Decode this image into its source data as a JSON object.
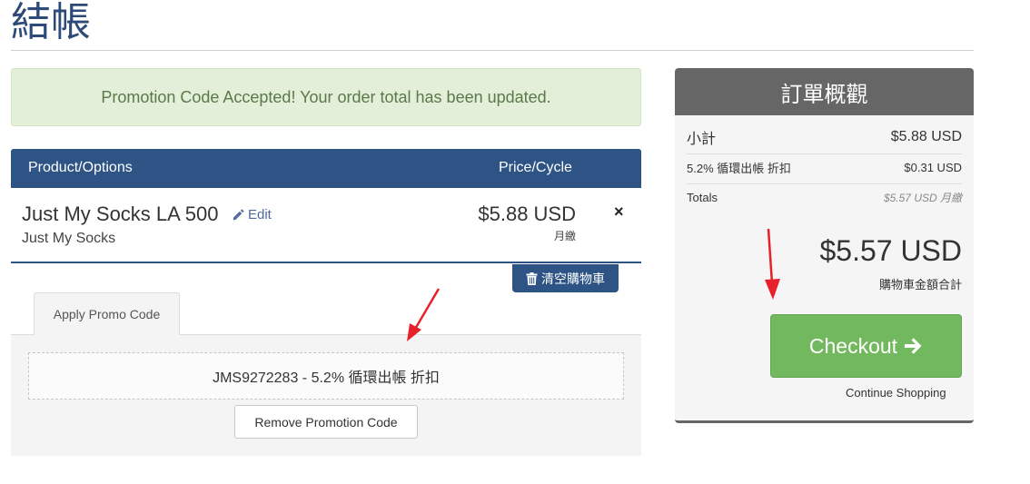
{
  "page": {
    "title": "結帳"
  },
  "alert": {
    "text": "Promotion Code Accepted! Your order total has been updated."
  },
  "cart": {
    "headers": {
      "product": "Product/Options",
      "price": "Price/Cycle"
    },
    "item": {
      "name": "Just My Socks LA 500",
      "edit_label": "Edit",
      "group": "Just My Socks",
      "price": "$5.88 USD",
      "cycle": "月繳",
      "remove_icon": "×"
    },
    "empty_cart_label": "清空購物車"
  },
  "promo": {
    "tab_label": "Apply Promo Code",
    "applied_code": "JMS9272283 - 5.2% 循環出帳 折扣",
    "remove_label": "Remove Promotion Code"
  },
  "summary": {
    "title": "訂單概觀",
    "subtotal_label": "小計",
    "subtotal_value": "$5.88 USD",
    "discount_label": "5.2% 循環出帳 折扣",
    "discount_value": "$0.31 USD",
    "totals_label": "Totals",
    "totals_value": "$5.57 USD 月繳",
    "total_due": "$5.57 USD",
    "total_due_label": "購物車金額合計",
    "checkout_label": "Checkout",
    "continue_label": "Continue Shopping"
  },
  "colors": {
    "brand_blue": "#2e5486",
    "checkout_green": "#72b85e",
    "summary_header": "#666666",
    "alert_bg": "#e3efd9",
    "annotation_arrow": "#e8202a"
  }
}
